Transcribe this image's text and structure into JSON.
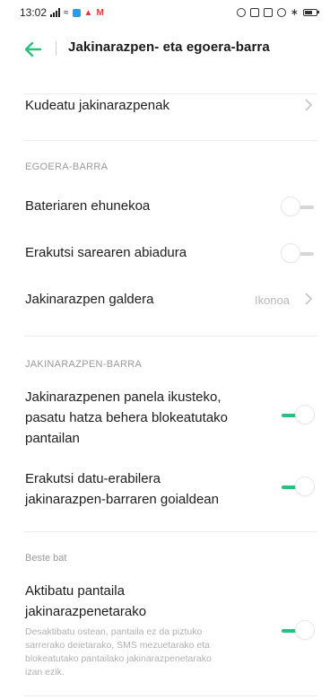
{
  "status_bar": {
    "time": "13:02",
    "carrier_mark": "M"
  },
  "header": {
    "title": "Jakinarazpen- eta egoera-barra"
  },
  "manage": {
    "label": "Kudeatu jakinarazpenak"
  },
  "status_section": {
    "title": "EGOERA-BARRA",
    "battery_percentage": {
      "label": "Bateriaren ehunekoa",
      "enabled": false
    },
    "network_speed": {
      "label": "Erakutsi sarearen abiadura",
      "enabled": false
    },
    "notification_style": {
      "label": "Jakinarazpen galdera",
      "value": "Ikonoa"
    }
  },
  "notif_section": {
    "title": "JAKINARAZPEN-BARRA",
    "swipe_panel": {
      "line1": "Jakinarazpenen panela ikusteko,",
      "line2": "pasatu hatza behera blokeatutako",
      "line3": "pantailan",
      "enabled": true
    },
    "data_usage": {
      "line1": "Erakutsi datu-erabilera",
      "line2": "jakinarazpen-barraren goialdean",
      "enabled": true
    }
  },
  "other_section": {
    "title": "Beste bat",
    "wake_screen": {
      "line1": "Aktibatu pantaila",
      "line2": "jakinarazpenetarako",
      "desc1": "Desaktibatu ostean, pantaila ez da piztuko",
      "desc2": "sarrerako deietarako, SMS mezuetarako eta",
      "desc3": "blokeatutako pantailako jakinarazpenetarako",
      "desc4": "izan ezik.",
      "enabled": true
    }
  },
  "colors": {
    "accent": "#27c07c"
  }
}
